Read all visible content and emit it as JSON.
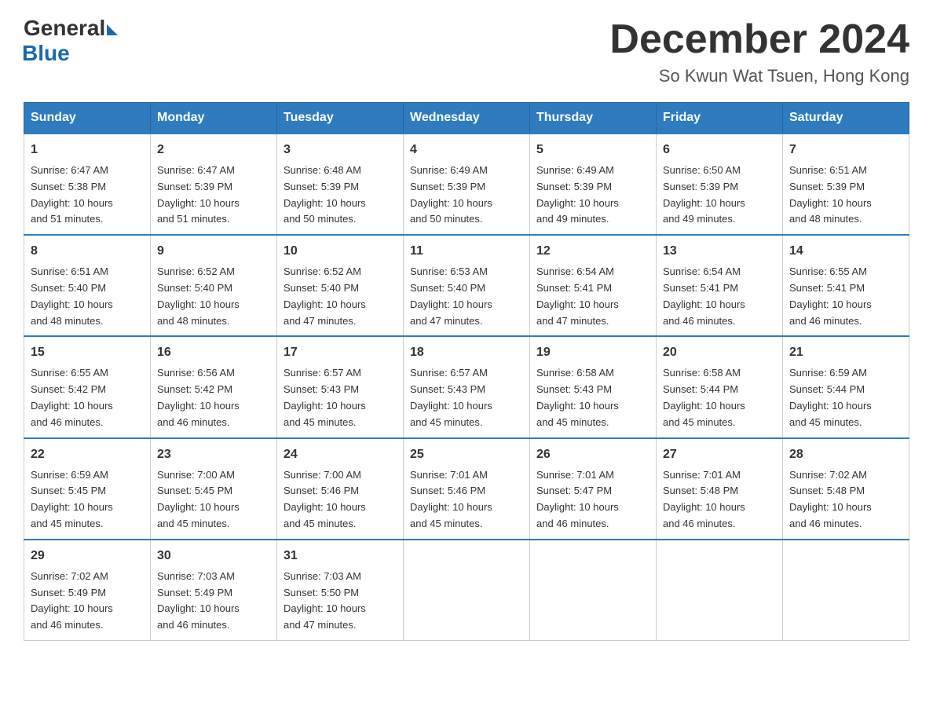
{
  "logo": {
    "general": "General",
    "blue": "Blue"
  },
  "title": "December 2024",
  "subtitle": "So Kwun Wat Tsuen, Hong Kong",
  "headers": [
    "Sunday",
    "Monday",
    "Tuesday",
    "Wednesday",
    "Thursday",
    "Friday",
    "Saturday"
  ],
  "weeks": [
    [
      {
        "day": "1",
        "info": "Sunrise: 6:47 AM\nSunset: 5:38 PM\nDaylight: 10 hours\nand 51 minutes."
      },
      {
        "day": "2",
        "info": "Sunrise: 6:47 AM\nSunset: 5:39 PM\nDaylight: 10 hours\nand 51 minutes."
      },
      {
        "day": "3",
        "info": "Sunrise: 6:48 AM\nSunset: 5:39 PM\nDaylight: 10 hours\nand 50 minutes."
      },
      {
        "day": "4",
        "info": "Sunrise: 6:49 AM\nSunset: 5:39 PM\nDaylight: 10 hours\nand 50 minutes."
      },
      {
        "day": "5",
        "info": "Sunrise: 6:49 AM\nSunset: 5:39 PM\nDaylight: 10 hours\nand 49 minutes."
      },
      {
        "day": "6",
        "info": "Sunrise: 6:50 AM\nSunset: 5:39 PM\nDaylight: 10 hours\nand 49 minutes."
      },
      {
        "day": "7",
        "info": "Sunrise: 6:51 AM\nSunset: 5:39 PM\nDaylight: 10 hours\nand 48 minutes."
      }
    ],
    [
      {
        "day": "8",
        "info": "Sunrise: 6:51 AM\nSunset: 5:40 PM\nDaylight: 10 hours\nand 48 minutes."
      },
      {
        "day": "9",
        "info": "Sunrise: 6:52 AM\nSunset: 5:40 PM\nDaylight: 10 hours\nand 48 minutes."
      },
      {
        "day": "10",
        "info": "Sunrise: 6:52 AM\nSunset: 5:40 PM\nDaylight: 10 hours\nand 47 minutes."
      },
      {
        "day": "11",
        "info": "Sunrise: 6:53 AM\nSunset: 5:40 PM\nDaylight: 10 hours\nand 47 minutes."
      },
      {
        "day": "12",
        "info": "Sunrise: 6:54 AM\nSunset: 5:41 PM\nDaylight: 10 hours\nand 47 minutes."
      },
      {
        "day": "13",
        "info": "Sunrise: 6:54 AM\nSunset: 5:41 PM\nDaylight: 10 hours\nand 46 minutes."
      },
      {
        "day": "14",
        "info": "Sunrise: 6:55 AM\nSunset: 5:41 PM\nDaylight: 10 hours\nand 46 minutes."
      }
    ],
    [
      {
        "day": "15",
        "info": "Sunrise: 6:55 AM\nSunset: 5:42 PM\nDaylight: 10 hours\nand 46 minutes."
      },
      {
        "day": "16",
        "info": "Sunrise: 6:56 AM\nSunset: 5:42 PM\nDaylight: 10 hours\nand 46 minutes."
      },
      {
        "day": "17",
        "info": "Sunrise: 6:57 AM\nSunset: 5:43 PM\nDaylight: 10 hours\nand 45 minutes."
      },
      {
        "day": "18",
        "info": "Sunrise: 6:57 AM\nSunset: 5:43 PM\nDaylight: 10 hours\nand 45 minutes."
      },
      {
        "day": "19",
        "info": "Sunrise: 6:58 AM\nSunset: 5:43 PM\nDaylight: 10 hours\nand 45 minutes."
      },
      {
        "day": "20",
        "info": "Sunrise: 6:58 AM\nSunset: 5:44 PM\nDaylight: 10 hours\nand 45 minutes."
      },
      {
        "day": "21",
        "info": "Sunrise: 6:59 AM\nSunset: 5:44 PM\nDaylight: 10 hours\nand 45 minutes."
      }
    ],
    [
      {
        "day": "22",
        "info": "Sunrise: 6:59 AM\nSunset: 5:45 PM\nDaylight: 10 hours\nand 45 minutes."
      },
      {
        "day": "23",
        "info": "Sunrise: 7:00 AM\nSunset: 5:45 PM\nDaylight: 10 hours\nand 45 minutes."
      },
      {
        "day": "24",
        "info": "Sunrise: 7:00 AM\nSunset: 5:46 PM\nDaylight: 10 hours\nand 45 minutes."
      },
      {
        "day": "25",
        "info": "Sunrise: 7:01 AM\nSunset: 5:46 PM\nDaylight: 10 hours\nand 45 minutes."
      },
      {
        "day": "26",
        "info": "Sunrise: 7:01 AM\nSunset: 5:47 PM\nDaylight: 10 hours\nand 46 minutes."
      },
      {
        "day": "27",
        "info": "Sunrise: 7:01 AM\nSunset: 5:48 PM\nDaylight: 10 hours\nand 46 minutes."
      },
      {
        "day": "28",
        "info": "Sunrise: 7:02 AM\nSunset: 5:48 PM\nDaylight: 10 hours\nand 46 minutes."
      }
    ],
    [
      {
        "day": "29",
        "info": "Sunrise: 7:02 AM\nSunset: 5:49 PM\nDaylight: 10 hours\nand 46 minutes."
      },
      {
        "day": "30",
        "info": "Sunrise: 7:03 AM\nSunset: 5:49 PM\nDaylight: 10 hours\nand 46 minutes."
      },
      {
        "day": "31",
        "info": "Sunrise: 7:03 AM\nSunset: 5:50 PM\nDaylight: 10 hours\nand 47 minutes."
      },
      {
        "day": "",
        "info": ""
      },
      {
        "day": "",
        "info": ""
      },
      {
        "day": "",
        "info": ""
      },
      {
        "day": "",
        "info": ""
      }
    ]
  ]
}
